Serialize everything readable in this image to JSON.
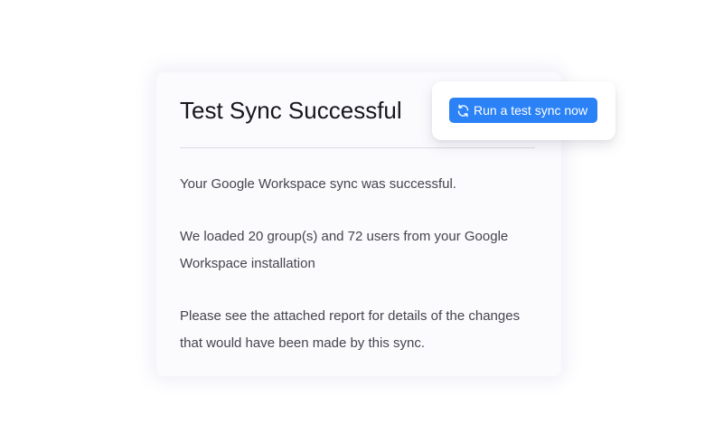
{
  "dialog": {
    "title": "Test Sync Successful",
    "paragraphs": [
      "Your Google Workspace sync was successful.",
      "We loaded 20 group(s) and 72 users from your Google Workspace installation",
      "Please see the attached report for details of the changes that would have been made by this sync."
    ]
  },
  "action": {
    "button_label": "Run a test sync now",
    "button_icon": "refresh-icon",
    "button_color": "#2b82f6"
  }
}
